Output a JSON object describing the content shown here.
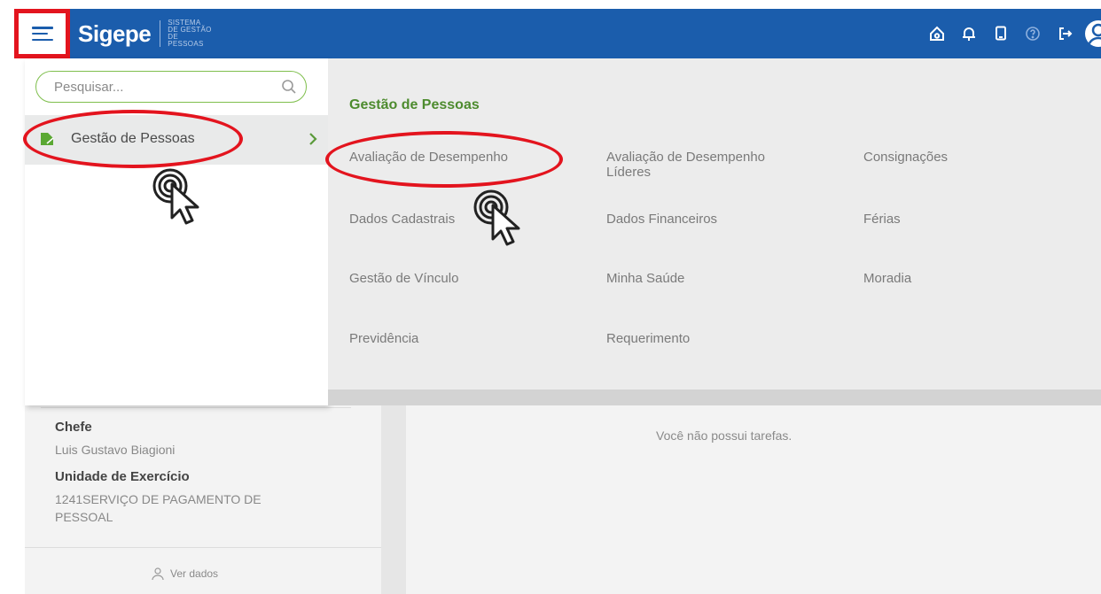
{
  "header": {
    "brand_name": "Sigepe",
    "brand_sub_line1": "SISTEMA",
    "brand_sub_line2": "DE GESTÃO",
    "brand_sub_line3": "DE PESSOAS",
    "icons": [
      "home-icon",
      "bell-icon",
      "tablet-icon",
      "help-icon",
      "logout-icon",
      "user-avatar-icon"
    ],
    "bar_color": "#1b5dac"
  },
  "sidebar": {
    "search_placeholder": "Pesquisar...",
    "items": [
      {
        "label": "Gestão de Pessoas",
        "active": true
      }
    ]
  },
  "submenu": {
    "title": "Gestão de Pessoas",
    "links": [
      "Avaliação de Desempenho",
      "Avaliação de Desempenho Líderes",
      "Consignações",
      "Dados Cadastrais",
      "Dados Financeiros",
      "Férias",
      "Gestão de Vínculo",
      "Minha Saúde",
      "Moradia",
      "Previdência",
      "Requerimento"
    ]
  },
  "profile_card": {
    "chefe_label": "Chefe",
    "chefe_value": "Luis Gustavo Biagioni",
    "unidade_label": "Unidade de Exercício",
    "unidade_value": "1241SERVIÇO DE PAGAMENTO DE PESSOAL",
    "ver_dados": "Ver dados"
  },
  "tasks": {
    "empty_message": "Você não possui tarefas."
  },
  "colors": {
    "accent_green": "#4d8b2e",
    "annotation_red": "#e3141e"
  }
}
